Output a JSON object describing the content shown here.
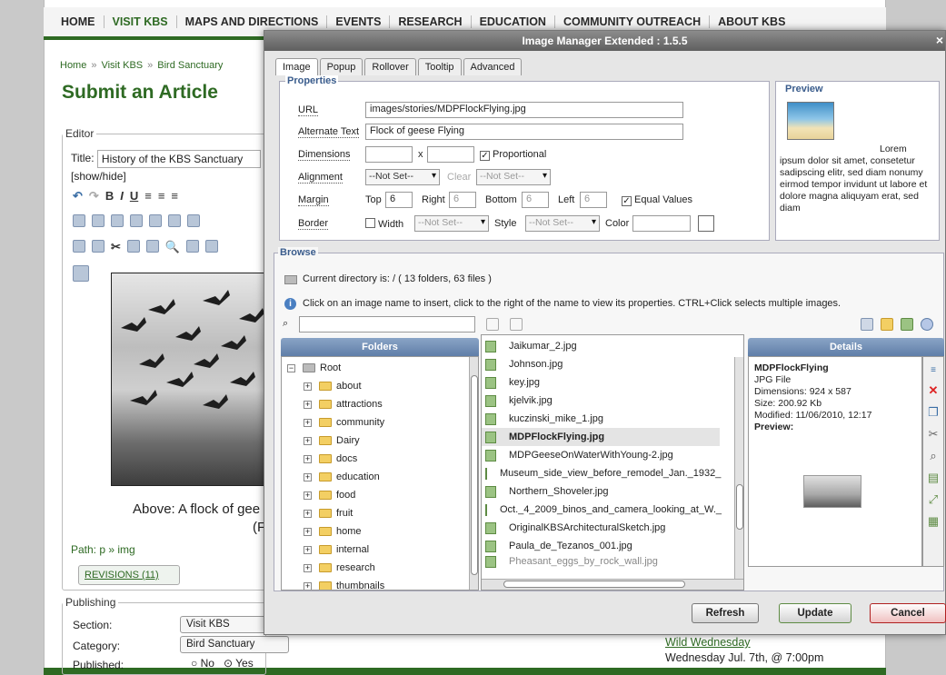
{
  "site_nav": [
    "HOME",
    "VISIT KBS",
    "MAPS AND DIRECTIONS",
    "EVENTS",
    "RESEARCH",
    "EDUCATION",
    "COMMUNITY OUTREACH",
    "ABOUT KBS"
  ],
  "breadcrumb": {
    "home": "Home",
    "sep": "»",
    "visit": "Visit KBS",
    "bird": "Bird Sanctuary"
  },
  "article": {
    "heading": "Submit an Article",
    "editor_legend": "Editor",
    "title_label": "Title:",
    "title_value": "History of the KBS Sanctuary",
    "show_hide": "[show/hide]",
    "caption_line1": "Above: A flock of gee",
    "caption_line2": "(F",
    "path": "Path: p » img",
    "revisions": "REVISIONS (11)"
  },
  "publishing": {
    "legend": "Publishing",
    "section_label": "Section:",
    "section_value": "Visit KBS",
    "category_label": "Category:",
    "category_value": "Bird Sanctuary",
    "published_label": "Published:",
    "no": "No",
    "yes": "Yes",
    "published_value": "Yes"
  },
  "event": {
    "title": "Wild Wednesday",
    "date": "Wednesday Jul. 7th, @ 7:00pm"
  },
  "dialog": {
    "title": "Image Manager Extended : 1.5.5",
    "close": "×",
    "tabs": [
      "Image",
      "Popup",
      "Rollover",
      "Tooltip",
      "Advanced"
    ],
    "active_tab": "Image",
    "properties": {
      "legend": "Properties",
      "url_label": "URL",
      "url_value": "images/stories/MDPFlockFlying.jpg",
      "alt_label": "Alternate Text",
      "alt_value": "Flock of geese Flying",
      "dimensions_label": "Dimensions",
      "x": "x",
      "proportional": "Proportional",
      "alignment_label": "Alignment",
      "align_value": "--Not Set--",
      "clear": "Clear",
      "clear_value": "--Not Set--",
      "margin_label": "Margin",
      "top": "Top",
      "top_value": "6",
      "right": "Right",
      "right_value": "6",
      "bottom": "Bottom",
      "bottom_value": "6",
      "left": "Left",
      "left_value": "6",
      "equal_values": "Equal Values",
      "border_label": "Border",
      "width": "Width",
      "width_value": "--Not Set--",
      "style": "Style",
      "style_value": "--Not Set--",
      "color": "Color"
    },
    "preview": {
      "legend": "Preview",
      "text": "Lorem ipsum dolor sit amet, consetetur sadipscing elitr, sed diam nonumy eirmod tempor invidunt ut labore et dolore magna aliquyam erat, sed diam"
    },
    "browse": {
      "legend": "Browse",
      "current_dir": "Current directory is: / ( 13 folders, 63 files )",
      "hint": "Click on an image name to insert, click to the right of the name to view its properties. CTRL+Click selects multiple images.",
      "folders_title": "Folders",
      "root": "Root",
      "folders": [
        "about",
        "attractions",
        "community",
        "Dairy",
        "docs",
        "education",
        "food",
        "fruit",
        "home",
        "internal",
        "research",
        "thumbnails"
      ],
      "files": [
        "Jaikumar_2.jpg",
        "Johnson.jpg",
        "key.jpg",
        "kjelvik.jpg",
        "kuczinski_mike_1.jpg",
        "MDPFlockFlying.jpg",
        "MDPGeeseOnWaterWithYoung-2.jpg",
        "Museum_side_view_before_remodel_Jan._1932_",
        "Northern_Shoveler.jpg",
        "Oct._4_2009_binos_and_camera_looking_at_W._",
        "OriginalKBSArchitecturalSketch.jpg",
        "Paula_de_Tezanos_001.jpg",
        "Pheasant_eggs_by_rock_wall.jpg"
      ],
      "selected_file": "MDPFlockFlying.jpg",
      "details_title": "Details",
      "details": {
        "name": "MDPFlockFlying",
        "type": "JPG File",
        "dimensions": "Dimensions: 924 x 587",
        "size": "Size: 200.92 Kb",
        "modified": "Modified: 11/06/2010, 12:17",
        "preview": "Preview:"
      }
    },
    "buttons": {
      "refresh": "Refresh",
      "update": "Update",
      "cancel": "Cancel"
    }
  }
}
